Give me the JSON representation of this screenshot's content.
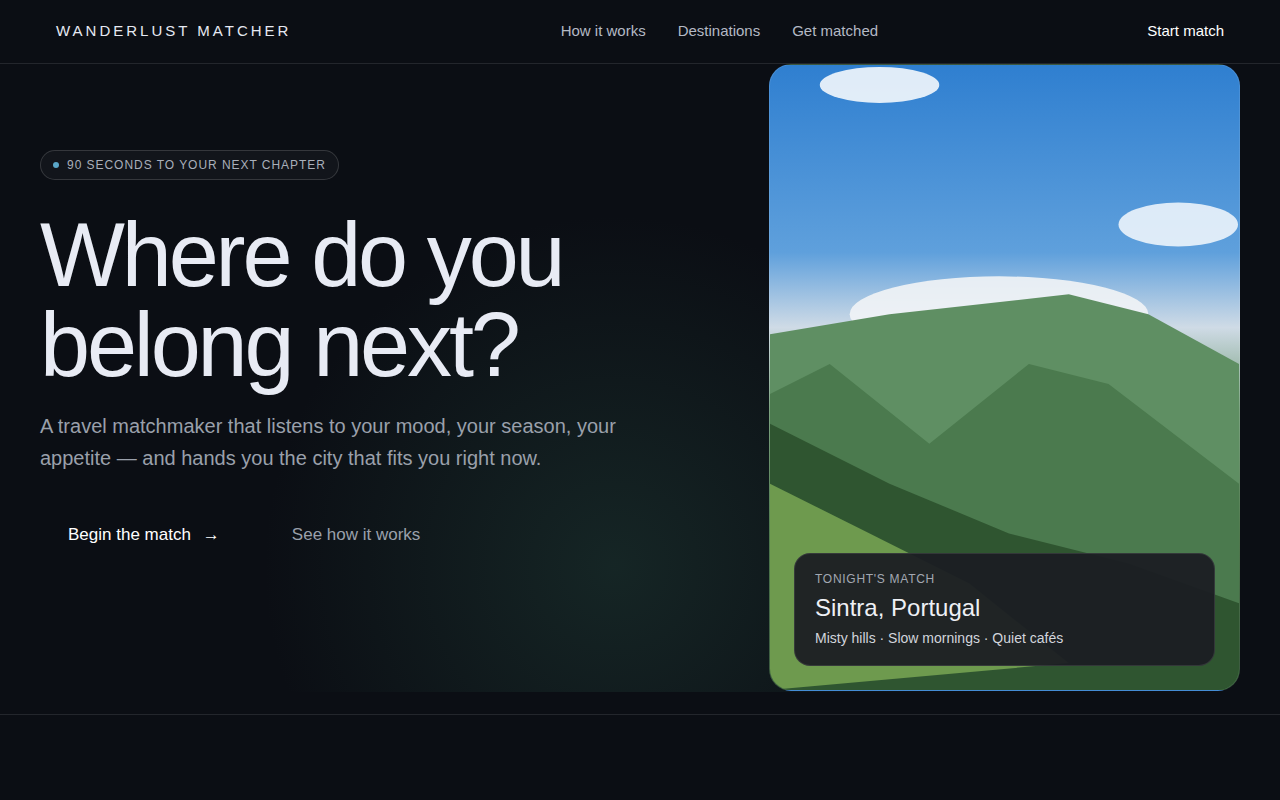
{
  "brand": "WANDERLUST MATCHER",
  "nav": [
    "How it works",
    "Destinations",
    "Get matched"
  ],
  "header_cta": "Start match",
  "hero": {
    "badge": "90 SECONDS TO YOUR NEXT CHAPTER",
    "title_lines": [
      "Where do you",
      "belong next?"
    ],
    "description": "A travel matchmaker that listens to your mood, your season, your appetite — and hands you the city that fits you right now.",
    "primary_button": {
      "label": "Begin the match",
      "icon": "→"
    },
    "secondary_button": "See how it works"
  },
  "match_card": {
    "eyebrow": "TONIGHT'S MATCH",
    "city": "Sintra, Portugal",
    "tags": "Misty hills · Slow mornings · Quiet cafés"
  }
}
